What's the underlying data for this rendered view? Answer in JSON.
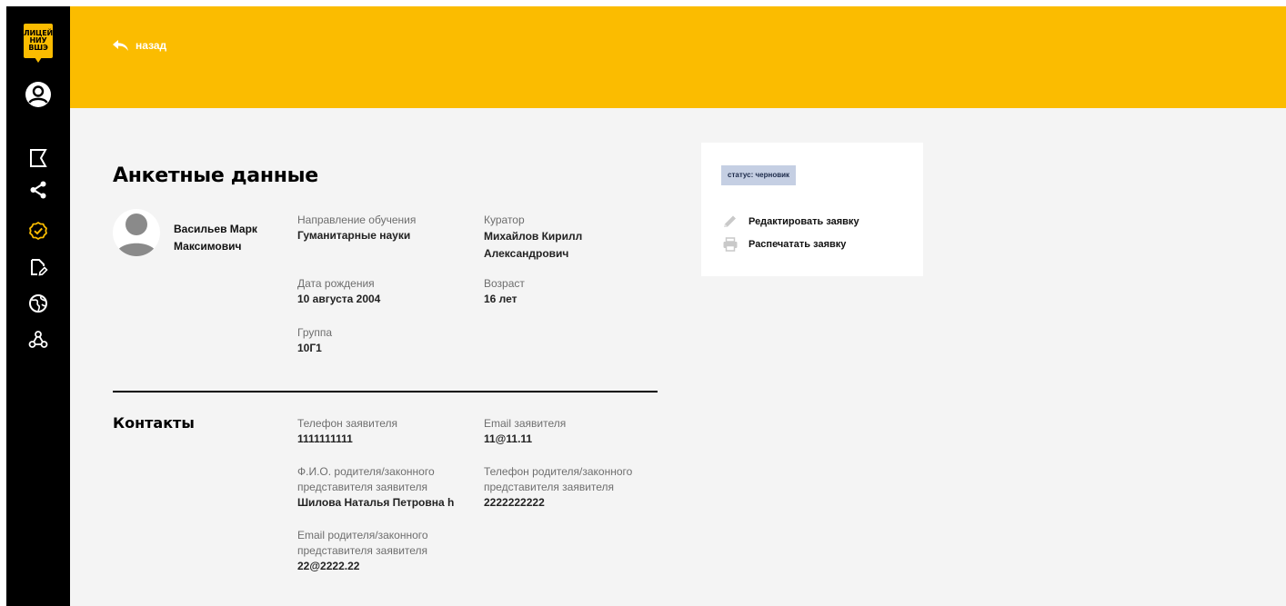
{
  "logo": {
    "line1": "ЛИЦЕЙ",
    "line2": "НИУ",
    "line3": "ВШЭ"
  },
  "sidebar": {
    "icons": [
      "user-circle-icon",
      "flag-icon",
      "share-icon",
      "check-circle-icon",
      "document-edit-icon",
      "globe-icon",
      "network-icon"
    ],
    "active_color": "#fbbc00"
  },
  "header": {
    "back_label": "назад",
    "color": "#fbbc00"
  },
  "profile": {
    "title": "Анкетные данные",
    "name": "Васильев Марк Максимович",
    "direction": {
      "label": "Направление обучения",
      "value": "Гуманитарные науки"
    },
    "curator": {
      "label": "Куратор",
      "value": "Михайлов Кирилл Александрович"
    },
    "birth_date": {
      "label": "Дата рождения",
      "value": "10 августа 2004"
    },
    "age": {
      "label": "Возраст",
      "value": "16 лет"
    },
    "group": {
      "label": "Группа",
      "value": "10Г1"
    }
  },
  "contacts": {
    "title": "Контакты",
    "applicant_phone": {
      "label": "Телефон заявителя",
      "value": "1111111111"
    },
    "applicant_email": {
      "label": "Email заявителя",
      "value": "11@11.11"
    },
    "parent_name": {
      "label": "Ф.И.О. родителя/законного представителя заявителя",
      "value": "Шилова Наталья Петровна h"
    },
    "parent_phone": {
      "label": "Телефон родителя/законного представителя заявителя",
      "value": "2222222222"
    },
    "parent_email": {
      "label": "Email родителя/законного представителя заявителя",
      "value": "22@2222.22"
    }
  },
  "status_card": {
    "status": "статус: черновик",
    "edit_label": "Редактировать заявку",
    "print_label": "Распечатать заявку"
  }
}
